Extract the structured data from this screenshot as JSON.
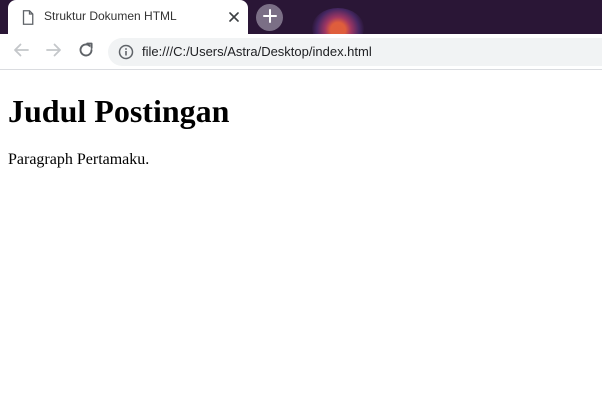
{
  "browser": {
    "tab": {
      "title": "Struktur Dokumen HTML",
      "icon": "document-icon",
      "close_icon": "close-icon"
    },
    "new_tab_icon": "plus-icon",
    "toolbar": {
      "back_icon": "arrow-left-icon",
      "forward_icon": "arrow-right-icon",
      "reload_icon": "reload-icon",
      "site_info_icon": "info-icon",
      "url": "file:///C:/Users/Astra/Desktop/index.html"
    },
    "colors": {
      "tabstrip_bg": "#2a1636",
      "omnibox_bg": "#f1f3f4",
      "icon_gray": "#5f6368"
    }
  },
  "page": {
    "heading": "Judul Postingan",
    "paragraph": "Paragraph Pertamaku."
  }
}
